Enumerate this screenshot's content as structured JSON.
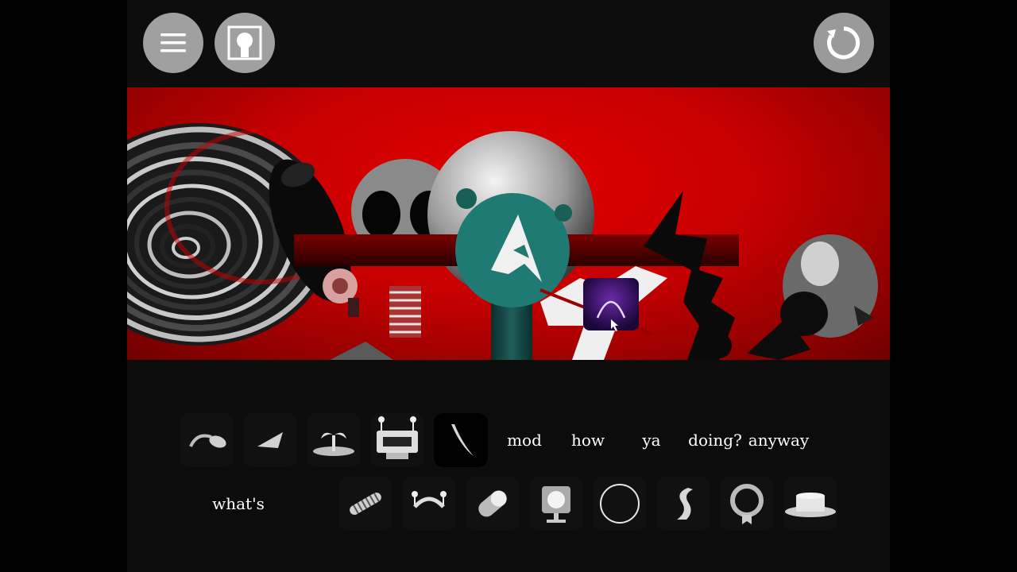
{
  "toolbar": {
    "menu_icon": "hamburger-icon",
    "bonus_icon": "character-portrait-icon",
    "reset_icon": "reset-circle-arrow-icon"
  },
  "stage": {
    "background_color": "#c80000",
    "characters": [
      {
        "name": "spiral-character"
      },
      {
        "name": "black-bottle-character"
      },
      {
        "name": "gear-face-character"
      },
      {
        "name": "big-eyed-gray-character"
      },
      {
        "name": "teal-a-logo-character"
      },
      {
        "name": "purple-cube-character"
      },
      {
        "name": "jagged-black-character"
      },
      {
        "name": "gray-masked-character"
      }
    ]
  },
  "palette": {
    "row1_icons": [
      {
        "name": "hook-curve-sound-icon",
        "used": true
      },
      {
        "name": "blade-wedge-sound-icon",
        "used": true
      },
      {
        "name": "island-palm-sound-icon",
        "used": true
      },
      {
        "name": "robot-head-sound-icon",
        "used": true
      },
      {
        "name": "claw-slash-sound-icon",
        "used": false
      }
    ],
    "row1_words": [
      "mod",
      "how",
      "ya",
      "doing?",
      "anyway"
    ],
    "row2_word": "what's",
    "row2_icons": [
      {
        "name": "spring-coil-sound-icon",
        "used": true
      },
      {
        "name": "antenna-mouth-sound-icon",
        "used": true
      },
      {
        "name": "pill-capsule-sound-icon",
        "used": true
      },
      {
        "name": "monitor-screen-sound-icon",
        "used": true
      },
      {
        "name": "circle-ring-sound-icon",
        "used": true
      },
      {
        "name": "s-wave-sound-icon",
        "used": true
      },
      {
        "name": "medal-ring-sound-icon",
        "used": true
      },
      {
        "name": "top-hat-sound-icon",
        "used": true
      }
    ]
  }
}
